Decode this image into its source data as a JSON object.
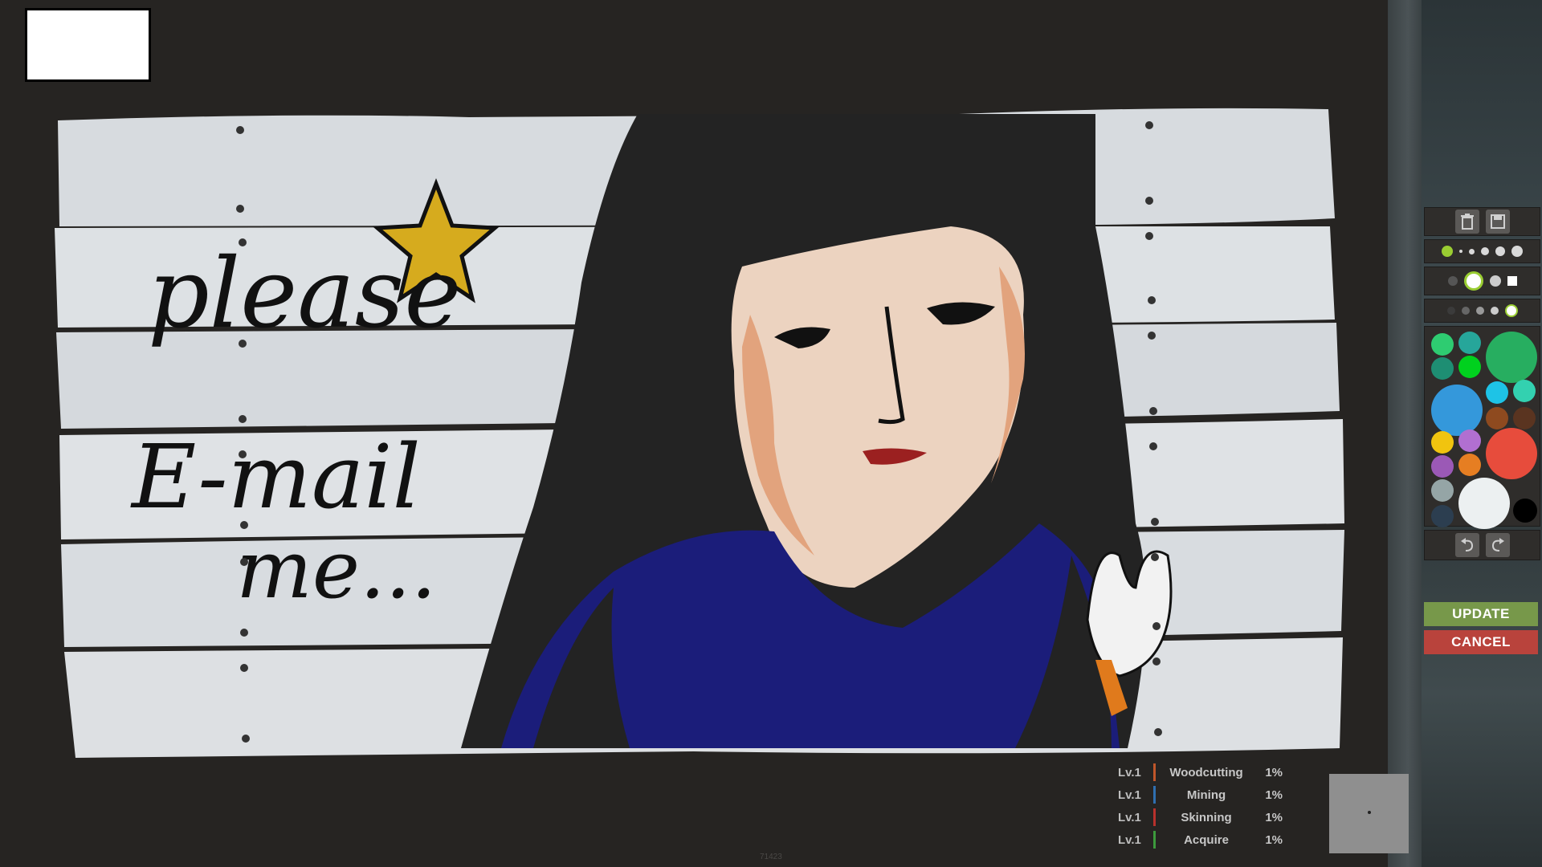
{
  "sign": {
    "line1": "please",
    "line2": "E-mail",
    "line3": "me..."
  },
  "toolbar": {
    "delete_icon": "trash-icon",
    "save_icon": "save-icon",
    "undo_icon": "undo-icon",
    "redo_icon": "redo-icon",
    "update_label": "UPDATE",
    "cancel_label": "CANCEL"
  },
  "palette": {
    "colors": [
      "#2ecc71",
      "#26a69a",
      "#27ae60",
      "#1e8e73",
      "#00d11e",
      "#3498db",
      "#1ec3e6",
      "#33d1b0",
      "#8e4a1f",
      "#5a3420",
      "#f1c40f",
      "#b16fd1",
      "#e74c3c",
      "#9b59b6",
      "#e67e22",
      "#95a5a6",
      "#ecf0f1",
      "#2c3e50",
      "#000000"
    ]
  },
  "skills": [
    {
      "level": "Lv.1",
      "name": "Woodcutting",
      "pct": "1%",
      "color": "#c0562a"
    },
    {
      "level": "Lv.1",
      "name": "Mining",
      "pct": "1%",
      "color": "#2f6fb0"
    },
    {
      "level": "Lv.1",
      "name": "Skinning",
      "pct": "1%",
      "color": "#b8312c"
    },
    {
      "level": "Lv.1",
      "name": "Acquire",
      "pct": "1%",
      "color": "#3c9a3c"
    }
  ],
  "build_id": "71423"
}
